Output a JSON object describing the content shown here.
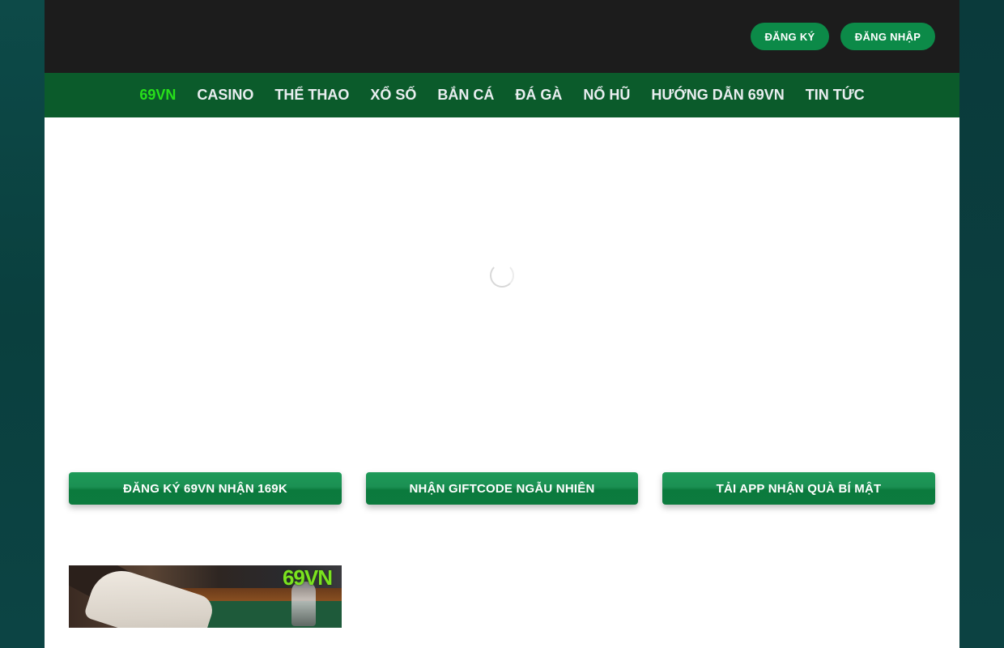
{
  "header": {
    "register_label": "ĐĂNG KÝ",
    "login_label": "ĐĂNG NHẬP"
  },
  "nav": {
    "items": [
      {
        "label": "69VN",
        "active": true
      },
      {
        "label": "CASINO"
      },
      {
        "label": "THỂ THAO"
      },
      {
        "label": "XỔ SỐ"
      },
      {
        "label": "BẮN CÁ"
      },
      {
        "label": "ĐÁ GÀ"
      },
      {
        "label": "NỔ HŨ"
      },
      {
        "label": "HƯỚNG DẪN 69VN"
      },
      {
        "label": "TIN TỨC"
      }
    ]
  },
  "main": {
    "loading_icon": "spinner-icon",
    "cta_buttons": [
      {
        "label": "ĐĂNG KÝ 69VN NHẬN 169K"
      },
      {
        "label": "NHẬN GIFTCODE NGẪU NHIÊN"
      },
      {
        "label": "TẢI APP NHẬN QUÀ BÍ MẬT"
      }
    ],
    "thumbnail": {
      "logo_text": "69VN"
    }
  },
  "colors": {
    "accent_green": "#0c8a48",
    "nav_bg": "#0b5b2b",
    "active_nav": "#27e01a",
    "topbar_bg": "#1c1c1c"
  }
}
